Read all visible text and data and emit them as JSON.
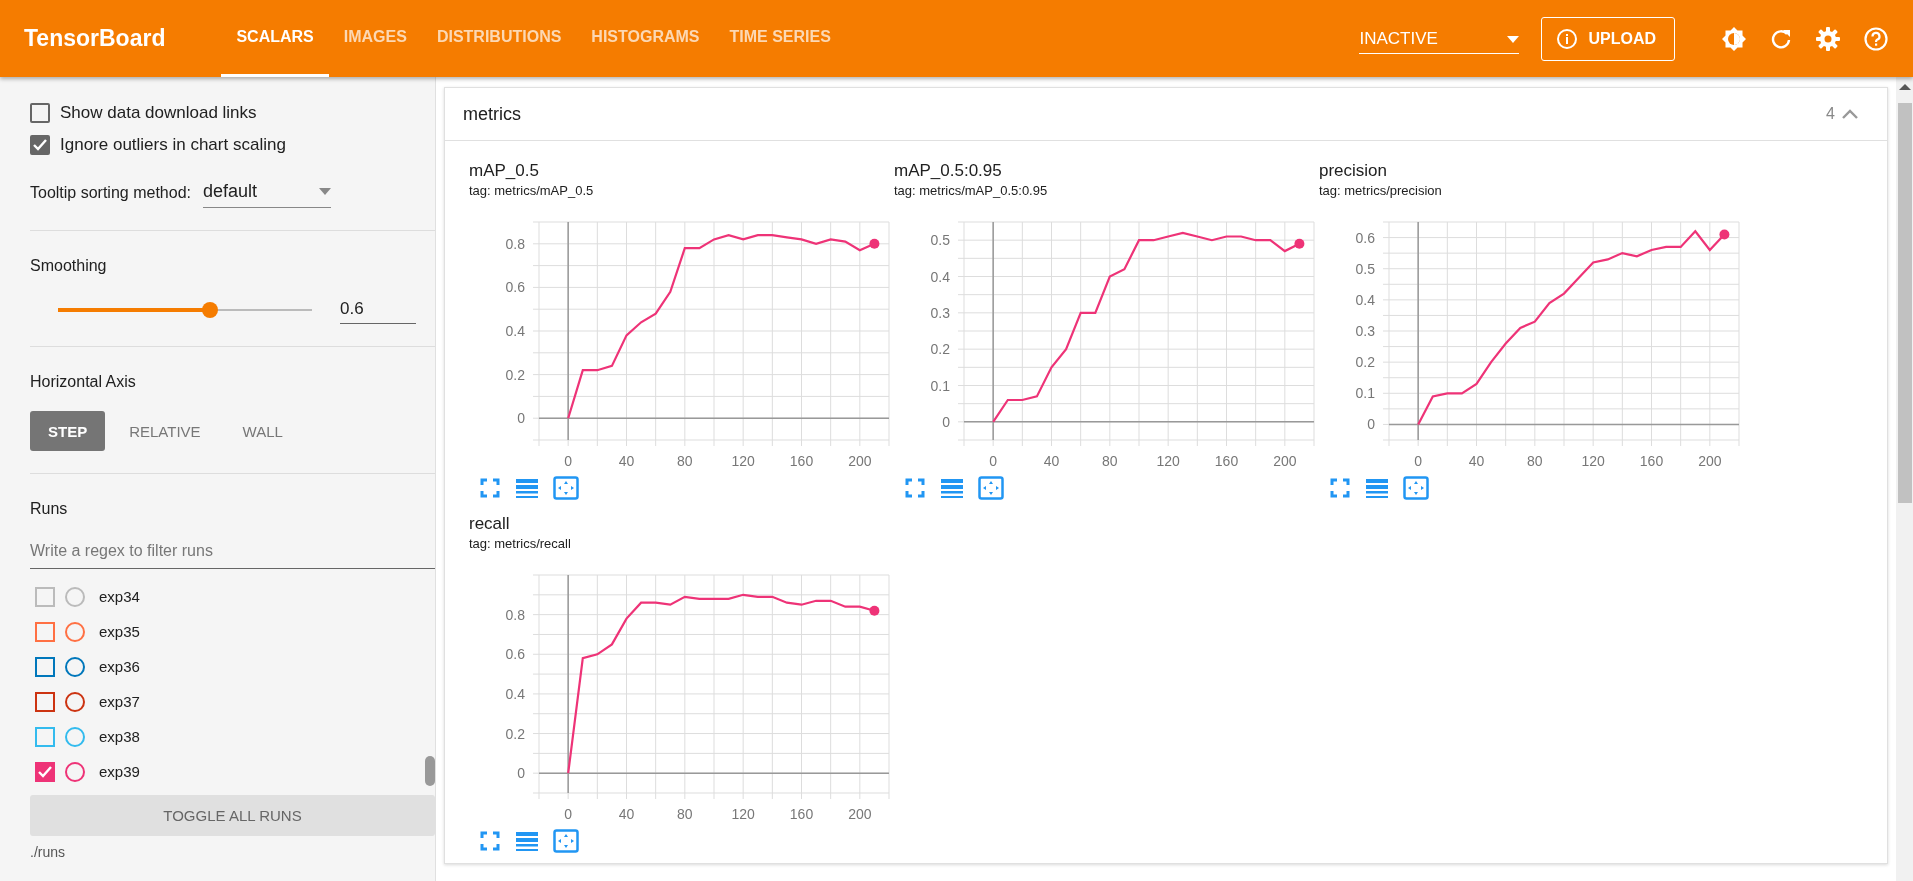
{
  "header": {
    "title": "TensorBoard",
    "tabs": [
      {
        "label": "SCALARS",
        "selected": true
      },
      {
        "label": "IMAGES",
        "selected": false
      },
      {
        "label": "DISTRIBUTIONS",
        "selected": false
      },
      {
        "label": "HISTOGRAMS",
        "selected": false
      },
      {
        "label": "TIME SERIES",
        "selected": false
      }
    ],
    "run_selector": "INACTIVE",
    "upload_button": "UPLOAD"
  },
  "sidebar": {
    "options": [
      {
        "label": "Show data download links",
        "checked": false
      },
      {
        "label": "Ignore outliers in chart scaling",
        "checked": true
      }
    ],
    "tooltip_sorting": {
      "label": "Tooltip sorting method:",
      "value": "default"
    },
    "smoothing": {
      "label": "Smoothing",
      "level": 0.6,
      "reading": "0.6"
    },
    "horizontal_axis": {
      "label": "Horizontal Axis",
      "options": [
        {
          "label": "STEP",
          "selected": true
        },
        {
          "label": "RELATIVE",
          "selected": false
        },
        {
          "label": "WALL",
          "selected": false
        }
      ]
    },
    "runs": {
      "label": "Runs",
      "filter_placeholder": "Write a regex to filter runs",
      "items": [
        {
          "name": "exp34",
          "color": "#bbbbbb",
          "checked": false
        },
        {
          "name": "exp35",
          "color": "#ff7043",
          "checked": false
        },
        {
          "name": "exp36",
          "color": "#0077bb",
          "checked": false
        },
        {
          "name": "exp37",
          "color": "#cc3311",
          "checked": false
        },
        {
          "name": "exp38",
          "color": "#33bbee",
          "checked": false
        },
        {
          "name": "exp39",
          "color": "#ee3377",
          "checked": true
        }
      ],
      "toggle_button": "TOGGLE ALL RUNS",
      "log_dir": "./runs"
    }
  },
  "main": {
    "group": {
      "title": "metrics",
      "count": "4",
      "expanded": true
    },
    "charts": [
      {
        "title": "mAP_0.5",
        "tag": "tag: metrics/mAP_0.5",
        "chart_data": {
          "type": "line",
          "grid": true,
          "x": [
            0,
            10,
            20,
            30,
            40,
            50,
            60,
            70,
            80,
            90,
            100,
            110,
            120,
            130,
            140,
            150,
            160,
            170,
            180,
            190,
            200,
            210
          ],
          "xlim": [
            -20,
            220
          ],
          "ylim": [
            -0.1,
            0.9
          ],
          "xticks": [
            0,
            40,
            80,
            120,
            160,
            200
          ],
          "yticks": [
            0,
            0.2,
            0.4,
            0.6,
            0.8
          ],
          "series": [
            {
              "color": "#ee3377",
              "values": [
                0,
                0.22,
                0.22,
                0.24,
                0.38,
                0.44,
                0.48,
                0.58,
                0.78,
                0.78,
                0.82,
                0.84,
                0.82,
                0.84,
                0.84,
                0.83,
                0.82,
                0.8,
                0.82,
                0.81,
                0.77,
                0.8
              ]
            }
          ]
        }
      },
      {
        "title": "mAP_0.5:0.95",
        "tag": "tag: metrics/mAP_0.5:0.95",
        "chart_data": {
          "type": "line",
          "grid": true,
          "x": [
            0,
            10,
            20,
            30,
            40,
            50,
            60,
            70,
            80,
            90,
            100,
            110,
            120,
            130,
            140,
            150,
            160,
            170,
            180,
            190,
            200,
            210
          ],
          "xlim": [
            -20,
            220
          ],
          "ylim": [
            -0.05,
            0.55
          ],
          "xticks": [
            0,
            40,
            80,
            120,
            160,
            200
          ],
          "yticks": [
            0,
            0.1,
            0.2,
            0.3,
            0.4,
            0.5
          ],
          "series": [
            {
              "color": "#ee3377",
              "values": [
                0,
                0.06,
                0.06,
                0.07,
                0.15,
                0.2,
                0.3,
                0.3,
                0.4,
                0.42,
                0.5,
                0.5,
                0.51,
                0.52,
                0.51,
                0.5,
                0.51,
                0.51,
                0.5,
                0.5,
                0.47,
                0.49
              ]
            }
          ]
        }
      },
      {
        "title": "precision",
        "tag": "tag: metrics/precision",
        "chart_data": {
          "type": "line",
          "grid": true,
          "x": [
            0,
            10,
            20,
            30,
            40,
            50,
            60,
            70,
            80,
            90,
            100,
            110,
            120,
            130,
            140,
            150,
            160,
            170,
            180,
            190,
            200,
            210
          ],
          "xlim": [
            -20,
            220
          ],
          "ylim": [
            -0.05,
            0.65
          ],
          "xticks": [
            0,
            40,
            80,
            120,
            160,
            200
          ],
          "yticks": [
            0,
            0.1,
            0.2,
            0.3,
            0.4,
            0.5,
            0.6
          ],
          "series": [
            {
              "color": "#ee3377",
              "values": [
                0,
                0.09,
                0.1,
                0.1,
                0.13,
                0.2,
                0.26,
                0.31,
                0.33,
                0.39,
                0.42,
                0.47,
                0.52,
                0.53,
                0.55,
                0.54,
                0.56,
                0.57,
                0.57,
                0.62,
                0.56,
                0.61
              ]
            }
          ]
        }
      },
      {
        "title": "recall",
        "tag": "tag: metrics/recall",
        "chart_data": {
          "type": "line",
          "grid": true,
          "x": [
            0,
            10,
            20,
            30,
            40,
            50,
            60,
            70,
            80,
            90,
            100,
            110,
            120,
            130,
            140,
            150,
            160,
            170,
            180,
            190,
            200,
            210
          ],
          "xlim": [
            -20,
            220
          ],
          "ylim": [
            -0.1,
            1.0
          ],
          "xticks": [
            0,
            40,
            80,
            120,
            160,
            200
          ],
          "yticks": [
            0,
            0.2,
            0.4,
            0.6,
            0.8
          ],
          "series": [
            {
              "color": "#ee3377",
              "values": [
                0,
                0.58,
                0.6,
                0.65,
                0.78,
                0.86,
                0.86,
                0.85,
                0.89,
                0.88,
                0.88,
                0.88,
                0.9,
                0.89,
                0.89,
                0.86,
                0.85,
                0.87,
                0.87,
                0.84,
                0.84,
                0.82
              ]
            }
          ]
        }
      }
    ]
  }
}
